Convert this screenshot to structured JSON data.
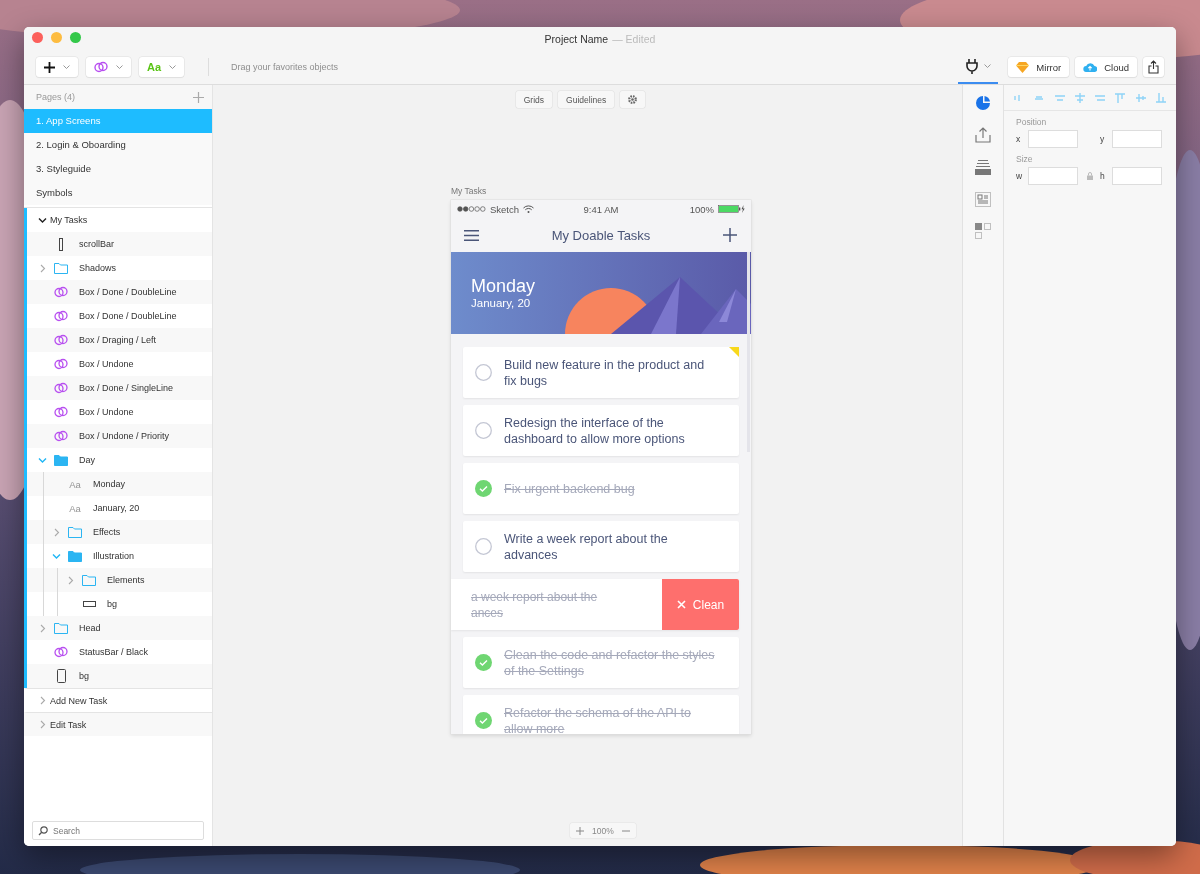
{
  "window": {
    "title": "Project Name",
    "status": "— Edited"
  },
  "toolbar": {
    "tools": [
      {
        "kind": "insert"
      },
      {
        "kind": "symbol"
      },
      {
        "kind": "text",
        "label": "Aa"
      }
    ],
    "hint": "Drag your favorites objects",
    "actions": [
      {
        "kind": "mirror",
        "label": "Mirror"
      },
      {
        "kind": "cloud",
        "label": "Cloud"
      },
      {
        "kind": "share"
      }
    ]
  },
  "pages": {
    "title": "Pages (4)",
    "items": [
      {
        "label": "1. App Screens",
        "selected": true
      },
      {
        "label": "2. Login & Oboarding",
        "selected": false
      },
      {
        "label": "3. Styleguide",
        "selected": false
      },
      {
        "label": "Symbols",
        "selected": false
      }
    ]
  },
  "layers": [
    {
      "label": "My Tasks",
      "kind": "artboard",
      "expanded": true,
      "children": [
        {
          "label": "scrollBar",
          "kind": "thin-rect"
        },
        {
          "label": "Shadows",
          "kind": "folder",
          "expanded": false
        },
        {
          "label": "Box / Done / DoubleLine",
          "kind": "symbol"
        },
        {
          "label": "Box / Done / DoubleLine",
          "kind": "symbol"
        },
        {
          "label": "Box / Draging / Left",
          "kind": "symbol"
        },
        {
          "label": "Box / Undone",
          "kind": "symbol"
        },
        {
          "label": "Box / Done / SingleLine",
          "kind": "symbol"
        },
        {
          "label": "Box / Undone",
          "kind": "symbol"
        },
        {
          "label": "Box / Undone / Priority",
          "kind": "symbol"
        },
        {
          "label": "Day",
          "kind": "folder",
          "expanded": true,
          "children": [
            {
              "label": "Monday",
              "kind": "text",
              "icon_text": "Aa"
            },
            {
              "label": "January, 20",
              "kind": "text",
              "icon_text": "Aa"
            },
            {
              "label": "Effects",
              "kind": "folder",
              "expanded": false
            },
            {
              "label": "Illustration",
              "kind": "folder",
              "expanded": true,
              "children": [
                {
                  "label": "Elements",
                  "kind": "folder",
                  "expanded": false
                },
                {
                  "label": "bg",
                  "kind": "wide-rect"
                }
              ]
            }
          ]
        },
        {
          "label": "Head",
          "kind": "folder",
          "expanded": false
        },
        {
          "label": "StatusBar / Black",
          "kind": "symbol"
        },
        {
          "label": "bg",
          "kind": "tall-rect"
        }
      ]
    },
    {
      "label": "Add New Task",
      "kind": "artboard",
      "expanded": false
    },
    {
      "label": "Edit Task",
      "kind": "artboard",
      "expanded": false
    }
  ],
  "layer_search": {
    "placeholder": "Search"
  },
  "canvas": {
    "buttons": [
      "Grids",
      "Guidelines"
    ],
    "zoom": "100%"
  },
  "artboard": {
    "label": "My Tasks",
    "carrier": "Sketch",
    "time": "9:41 AM",
    "battery": "100%",
    "title": "My Doable Tasks",
    "day": "Monday",
    "date": "January, 20",
    "tasks": [
      {
        "kind": "card",
        "text": "Build new feature in the product and fix bugs",
        "done": false,
        "priority": true
      },
      {
        "kind": "card",
        "text": "Redesign the interface of the dashboard to allow more options",
        "done": false,
        "priority": false
      },
      {
        "kind": "card",
        "text": "Fix urgent backend bug",
        "done": true,
        "priority": false
      },
      {
        "kind": "card",
        "text": "Write a week report about the advances",
        "done": false,
        "priority": false
      },
      {
        "kind": "swiped",
        "lines": [
          "a week report about the",
          "ances"
        ],
        "done": true,
        "action": "Clean"
      },
      {
        "kind": "card",
        "text": "Clean the code and refactor the styles of the Settings",
        "done": true,
        "priority": false
      },
      {
        "kind": "card",
        "text": "Refactor the schema of the API to allow more",
        "done": true,
        "priority": false
      }
    ]
  },
  "inspector": {
    "tabs": [
      {
        "kind": "style",
        "selected": true
      },
      {
        "kind": "export",
        "selected": false
      },
      {
        "kind": "stack",
        "selected": false
      },
      {
        "kind": "document",
        "selected": false
      },
      {
        "kind": "grid",
        "selected": false
      }
    ],
    "position": {
      "label": "Position",
      "fields": [
        {
          "label": "x"
        },
        {
          "label": "y"
        }
      ]
    },
    "size": {
      "label": "Size",
      "fields": [
        {
          "label": "w"
        },
        {
          "label": "h"
        }
      ]
    }
  }
}
